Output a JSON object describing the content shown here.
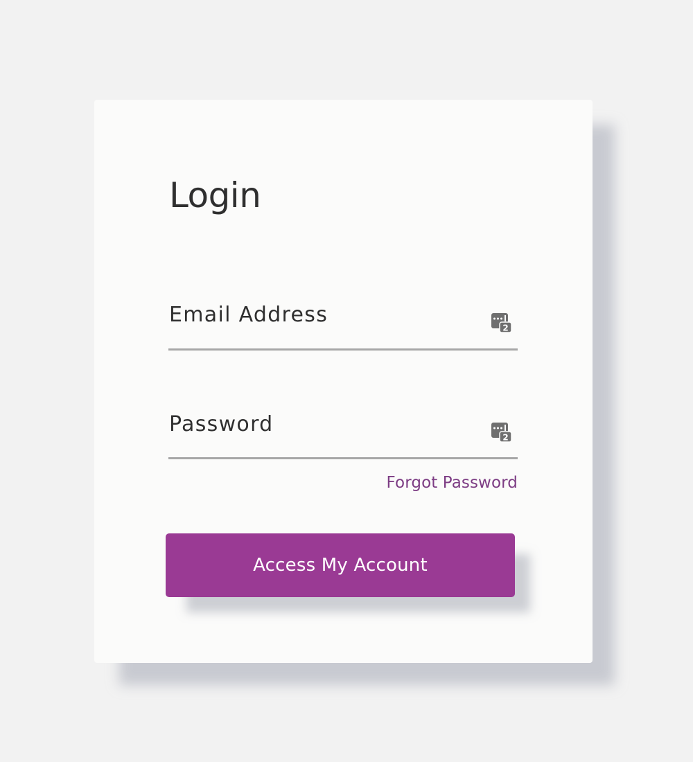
{
  "login_form": {
    "title": "Login",
    "email_field": {
      "placeholder": "Email Address",
      "value": "",
      "autofill_icon": "password-manager-icon"
    },
    "password_field": {
      "placeholder": "Password",
      "value": "",
      "autofill_icon": "password-manager-icon"
    },
    "forgot_password_label": "Forgot Password",
    "submit_label": "Access My Account"
  },
  "colors": {
    "background": "#f2f2f2",
    "card": "#fbfbfa",
    "accent": "#9a3a94",
    "link": "#7d3d84",
    "text": "#2f2f2f",
    "field_underline": "#a7a7a7"
  }
}
